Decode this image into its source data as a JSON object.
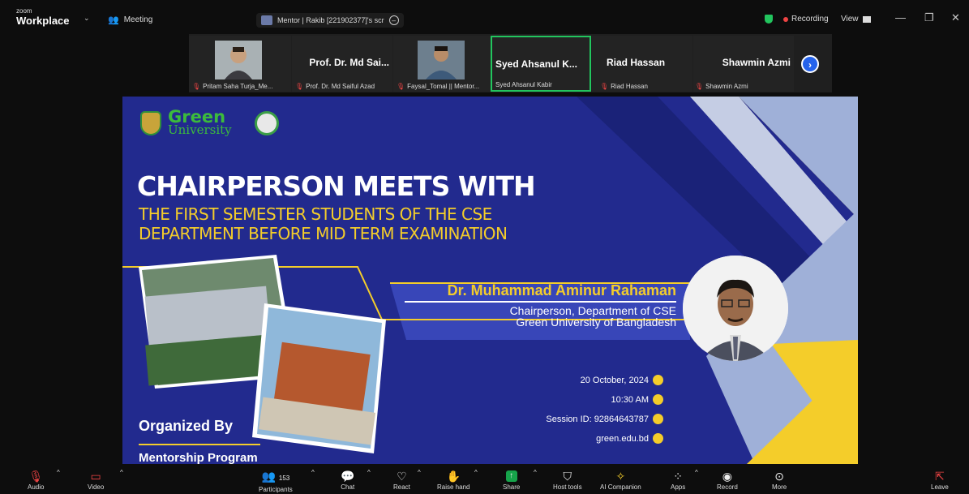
{
  "titlebar": {
    "brand_small": "zoom",
    "brand_main": "Workplace",
    "meeting_label": "Meeting",
    "share_label": "Mentor | Rakib [221902377]'s scr",
    "recording_label": "Recording",
    "view_label": "View",
    "minimize": "—",
    "restore": "❐",
    "close": "✕"
  },
  "participants": [
    {
      "big_name": "",
      "small_name": "Pritam Saha Turja_Me...",
      "photo": "#7d6b5c",
      "muted": true
    },
    {
      "big_name": "Prof. Dr. Md Sai...",
      "small_name": "Prof. Dr. Md Saiful Azad",
      "photo": "",
      "muted": true
    },
    {
      "big_name": "",
      "small_name": "Faysal_Tomal || Mentor...",
      "photo": "#8a7358",
      "muted": true
    },
    {
      "big_name": "Syed Ahsanul K...",
      "small_name": "Syed Ahsanul Kabir",
      "photo": "",
      "muted": false,
      "active": true
    },
    {
      "big_name": "Riad Hassan",
      "small_name": "Riad Hassan",
      "photo": "",
      "muted": true
    },
    {
      "big_name": "Shawmin Azmi",
      "small_name": "Shawmin Azmi",
      "photo": "",
      "muted": true
    }
  ],
  "slide": {
    "logo_word1": "Green",
    "logo_word2": "University",
    "title_line1": "CHAIRPERSON MEETS WITH",
    "title_line2": "THE FIRST SEMESTER STUDENTS OF THE CSE",
    "title_line3": "DEPARTMENT BEFORE MID TERM EXAMINATION",
    "speaker_name": "Dr. Muhammad Aminur Rahaman",
    "speaker_role1": "Chairperson, Department of CSE",
    "speaker_role2": "Green University of Bangladesh",
    "date": "20 October, 2024",
    "time": "10:30 AM",
    "session": "Session ID: 92864643787",
    "website": "green.edu.bd",
    "organized_by": "Organized By",
    "organizer": "Mentorship Program"
  },
  "toolbar": {
    "audio": "Audio",
    "video": "Video",
    "participants": "Participants",
    "participant_count": "153",
    "chat": "Chat",
    "react": "React",
    "raise_hand": "Raise hand",
    "share": "Share",
    "host_tools": "Host tools",
    "ai_companion": "AI Companion",
    "apps": "Apps",
    "record": "Record",
    "more": "More",
    "leave": "Leave"
  },
  "colors": {
    "accent_green": "#22c55e",
    "slide_navy": "#222a8e",
    "slide_yellow": "#f4cd2a",
    "recording_red": "#ef4444",
    "share_green": "#16a34a"
  }
}
